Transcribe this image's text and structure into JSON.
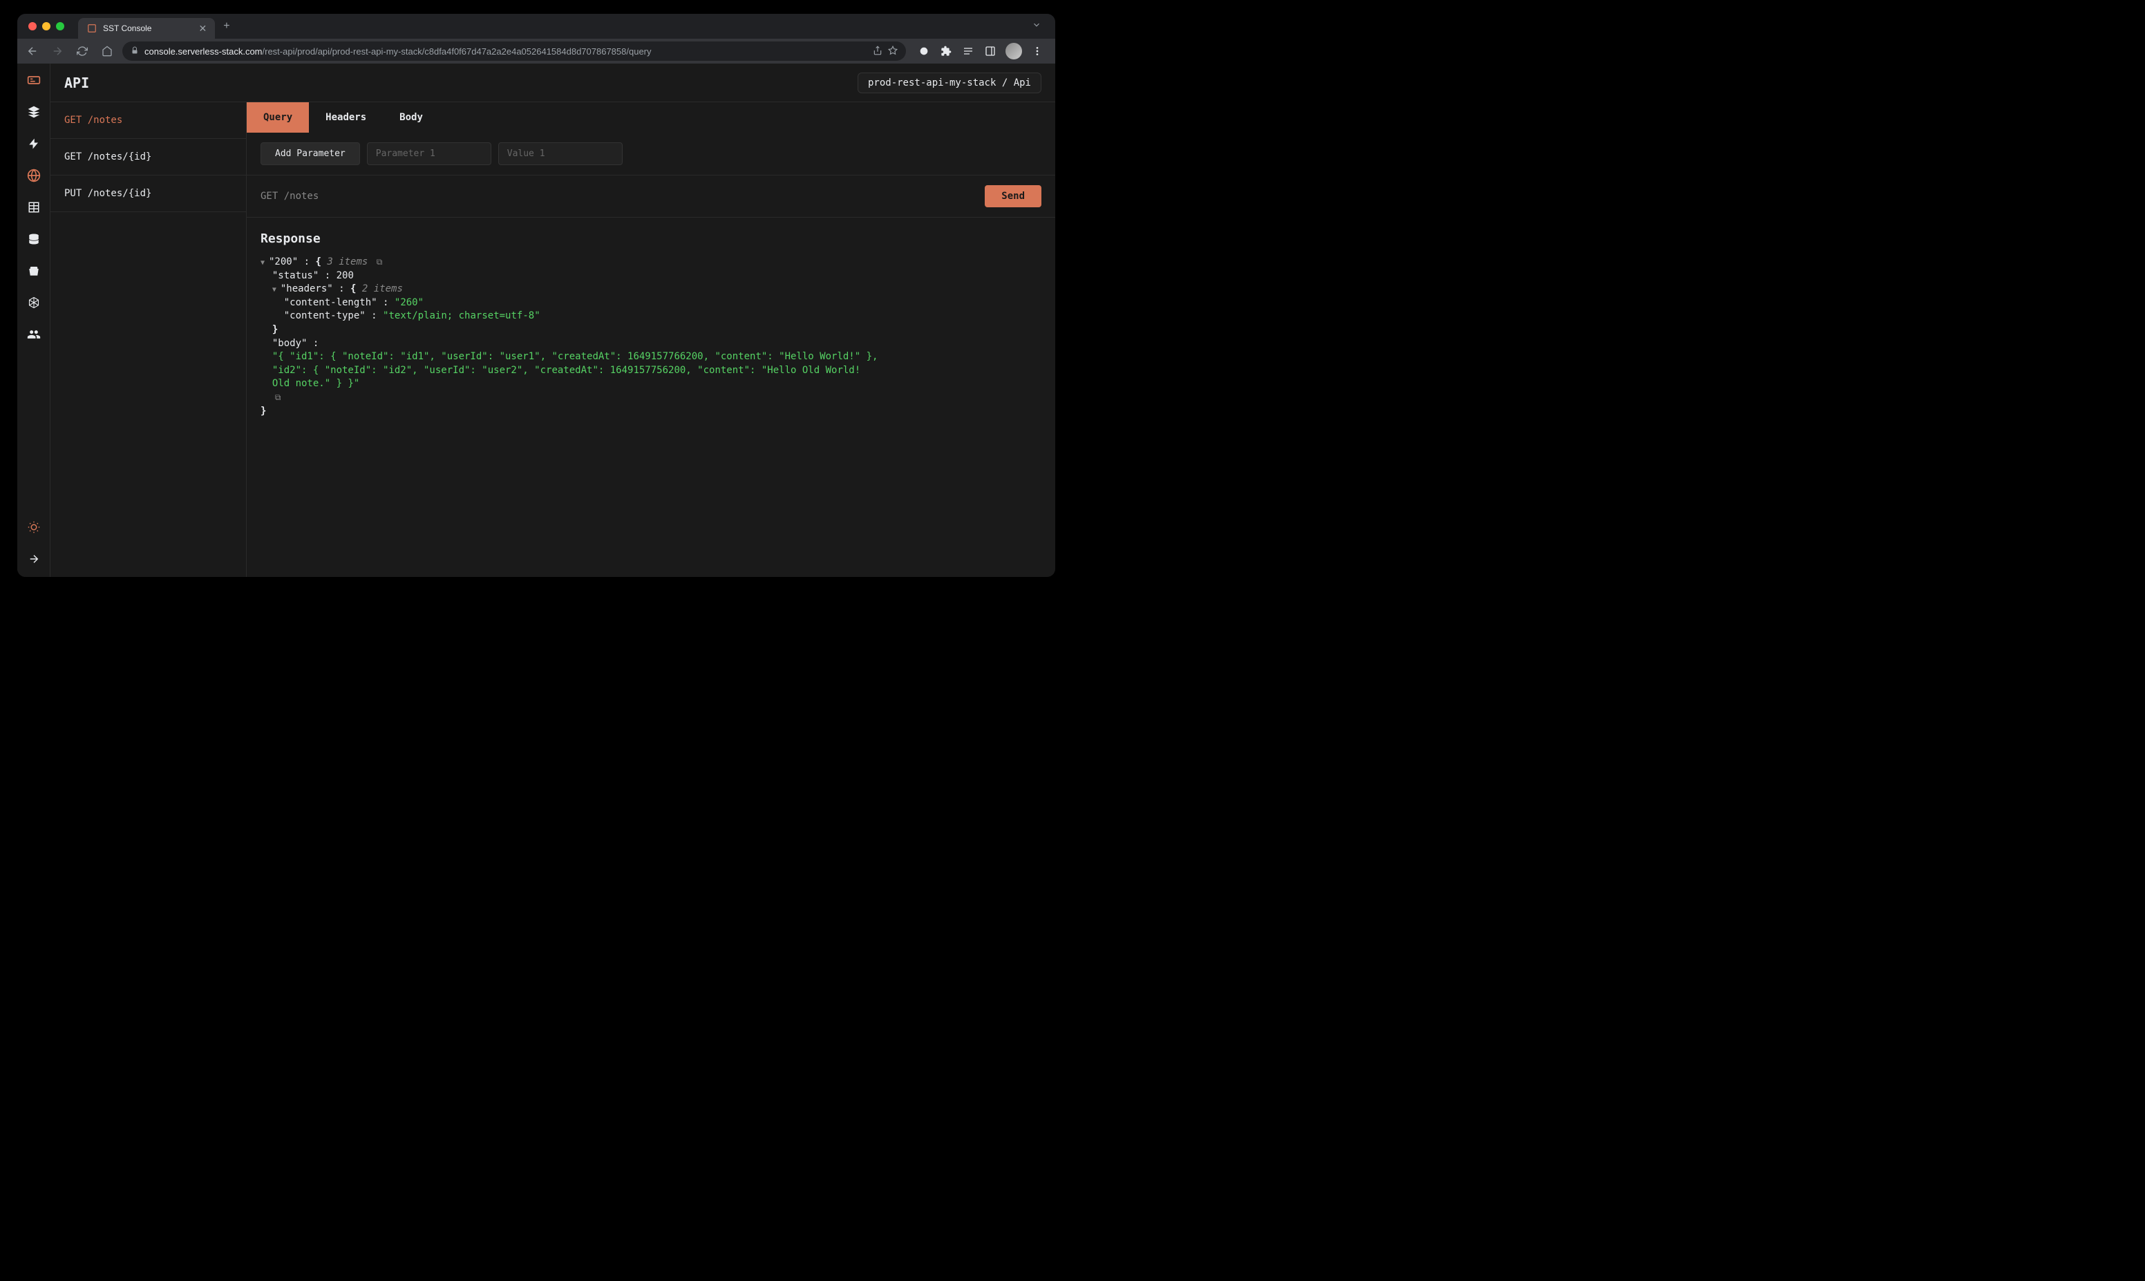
{
  "browser": {
    "tab_title": "SST Console",
    "url_domain": "console.serverless-stack.com",
    "url_path": "/rest-api/prod/api/prod-rest-api-my-stack/c8dfa4f0f67d47a2a2e4a052641584d8d707867858/query"
  },
  "page": {
    "title": "API",
    "breadcrumb": "prod-rest-api-my-stack / Api"
  },
  "routes": [
    {
      "label": "GET /notes",
      "active": true
    },
    {
      "label": "GET /notes/{id}",
      "active": false
    },
    {
      "label": "PUT /notes/{id}",
      "active": false
    }
  ],
  "tabs": [
    {
      "label": "Query",
      "active": true
    },
    {
      "label": "Headers",
      "active": false
    },
    {
      "label": "Body",
      "active": false
    }
  ],
  "params": {
    "add_label": "Add Parameter",
    "name_placeholder": "Parameter 1",
    "value_placeholder": "Value 1"
  },
  "request": {
    "line": "GET /notes",
    "send_label": "Send"
  },
  "response": {
    "title": "Response",
    "status_key": "\"200\"",
    "root_count": "3 items",
    "status_label": "\"status\"",
    "status_value": "200",
    "headers_label": "\"headers\"",
    "headers_count": "2 items",
    "content_length_key": "\"content-length\"",
    "content_length_val": "\"260\"",
    "content_type_key": "\"content-type\"",
    "content_type_val": "\"text/plain; charset=utf-8\"",
    "body_label": "\"body\"",
    "body_line1": "\"{ \"id1\": { \"noteId\": \"id1\", \"userId\": \"user1\", \"createdAt\": 1649157766200, \"content\": \"Hello World!\" },",
    "body_line2": "\"id2\": { \"noteId\": \"id2\", \"userId\": \"user2\", \"createdAt\": 1649157756200, \"content\": \"Hello Old World!",
    "body_line3": "Old note.\" } }\""
  }
}
